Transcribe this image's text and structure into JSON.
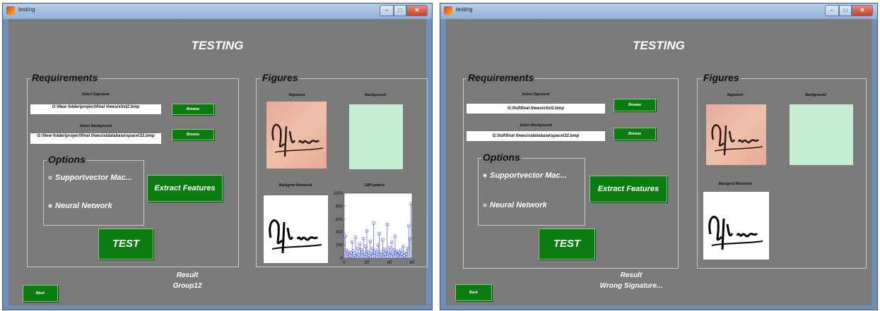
{
  "colors": {
    "panel_bg": "#7a7a7a",
    "button_green": "#0b7d10",
    "window_frame": "#6f8fb8"
  },
  "windows": [
    {
      "title": "testing",
      "page_title": "TESTING",
      "requirements_title": "Requirements",
      "signature_label": "Select Signature",
      "signature_path": "G:\\New folder\\project\\final theesis\\tst2.bmp",
      "background_label": "Select Background",
      "background_path": "G:\\New folder\\project\\final theesis\\database\\space\\32.bmp",
      "browse_label": "Browse",
      "options_title": "Options",
      "option_svm": "Supportvector Mac...",
      "option_nn": "Neural Network",
      "selected_option": "svm",
      "extract_label": "Extract Features",
      "test_label": "TEST",
      "figures_title": "Figures",
      "fig_signature": "Signature",
      "fig_background": "Background",
      "fig_bg_removed": "Backgrnd Removed",
      "fig_lbp": "LBP pattern",
      "result_label": "Result",
      "result_value": "Group12",
      "back_label": "Back"
    },
    {
      "title": "testing",
      "page_title": "TESTING",
      "requirements_title": "Requirements",
      "signature_label": "Select Signature",
      "signature_path": "G:\\full\\final theesis\\tst2.bmp",
      "background_label": "Select Background",
      "background_path": "G:\\full\\final theesis\\database\\space\\32.bmp",
      "browse_label": "Browse",
      "options_title": "Options",
      "option_svm": "Supportvector Mac...",
      "option_nn": "Neural Network",
      "selected_option": "nn",
      "extract_label": "Extract Features",
      "test_label": "TEST",
      "figures_title": "Figures",
      "fig_signature": "Signature",
      "fig_background": "Background",
      "fig_bg_removed": "Backgrnd Removed",
      "result_label": "Result",
      "result_value": "Wrong Signature...",
      "back_label": "Back"
    }
  ],
  "chart_data": {
    "type": "scatter",
    "title": "LBP pattern",
    "xlabel": "",
    "ylabel": "",
    "xlim": [
      0,
      60
    ],
    "ylim": [
      0,
      1000
    ],
    "xticks": [
      0,
      20,
      40,
      60
    ],
    "yticks": [
      0,
      200,
      400,
      600,
      800,
      1000
    ],
    "x": [
      1,
      2,
      3,
      4,
      5,
      6,
      7,
      8,
      9,
      10,
      11,
      12,
      13,
      14,
      15,
      16,
      17,
      18,
      19,
      20,
      21,
      22,
      23,
      24,
      25,
      26,
      27,
      28,
      29,
      30,
      31,
      32,
      33,
      34,
      35,
      36,
      37,
      38,
      39,
      40,
      41,
      42,
      43,
      44,
      45,
      46,
      47,
      48,
      49,
      50,
      51,
      52,
      53,
      54,
      55,
      56,
      57,
      58,
      59
    ],
    "y": [
      340,
      120,
      60,
      90,
      30,
      80,
      250,
      110,
      40,
      320,
      70,
      150,
      50,
      220,
      130,
      90,
      300,
      60,
      180,
      420,
      100,
      40,
      260,
      70,
      150,
      540,
      80,
      120,
      60,
      200,
      380,
      90,
      50,
      280,
      140,
      60,
      110,
      520,
      70,
      160,
      90,
      250,
      60,
      130,
      340,
      80,
      100,
      50,
      70,
      120,
      60,
      180,
      40,
      90,
      60,
      150,
      500,
      300,
      840
    ]
  }
}
